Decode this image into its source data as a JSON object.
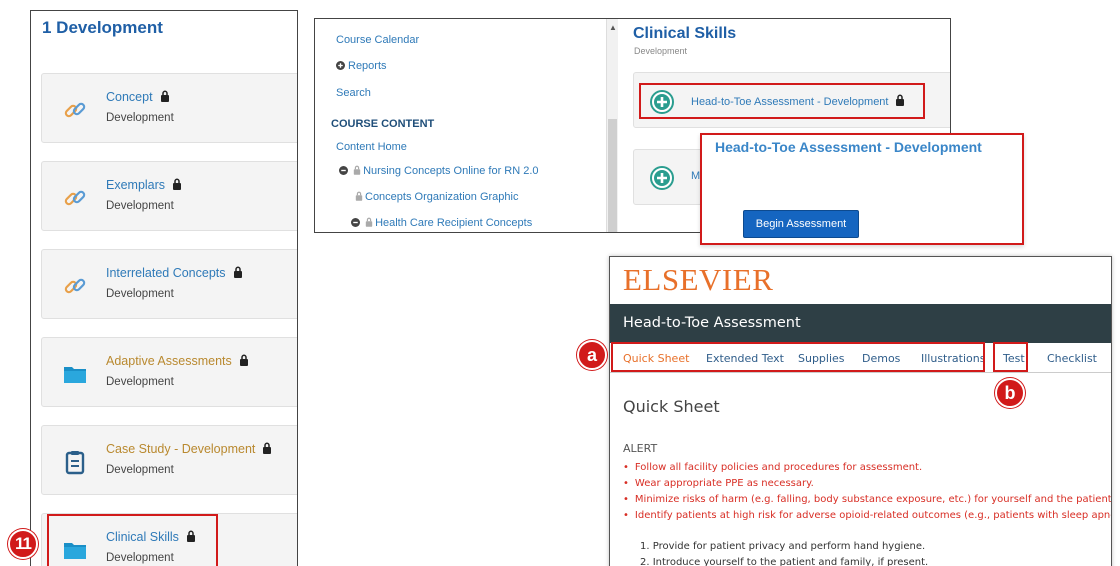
{
  "left_panel": {
    "title": "1 Development",
    "modules": [
      {
        "title": "Concept",
        "subtitle": "Development",
        "icon": "link-icon",
        "color": "blue"
      },
      {
        "title": "Exemplars",
        "subtitle": "Development",
        "icon": "link-icon",
        "color": "blue"
      },
      {
        "title": "Interrelated Concepts",
        "subtitle": "Development",
        "icon": "link-icon",
        "color": "blue"
      },
      {
        "title": "Adaptive Assessments",
        "subtitle": "Development",
        "icon": "folder-icon",
        "color": "orange"
      },
      {
        "title": "Case Study - Development",
        "subtitle": "Development",
        "icon": "clipboard-icon",
        "color": "orange"
      },
      {
        "title": "Clinical Skills",
        "subtitle": "Development",
        "icon": "folder-icon",
        "color": "blue"
      }
    ]
  },
  "mid_panel": {
    "sidebar": {
      "course_calendar": "Course Calendar",
      "reports": "Reports",
      "search": "Search",
      "course_content_heading": "COURSE CONTENT",
      "content_home": "Content Home",
      "tree": [
        "Nursing Concepts Online for RN 2.0",
        "Concepts Organization Graphic",
        "Health Care Recipient Concepts"
      ]
    },
    "main": {
      "title": "Clinical Skills",
      "subtitle": "Development",
      "cards": [
        {
          "text": "Head-to-Toe Assessment - Development"
        },
        {
          "text": "M"
        }
      ]
    }
  },
  "popup": {
    "title": "Head-to-Toe Assessment - Development",
    "button_label": "Begin Assessment"
  },
  "elsevier": {
    "logo": "ELSEVIER",
    "bar_title": "Head-to-Toe Assessment",
    "tabs": [
      "Quick Sheet",
      "Extended Text",
      "Supplies",
      "Demos",
      "Illustrations",
      "Test",
      "Checklist"
    ],
    "active_tab": "Quick Sheet",
    "section_title": "Quick Sheet",
    "alert_label": "ALERT",
    "alerts": [
      "Follow all facility policies and procedures for assessment.",
      "Wear appropriate PPE as necessary.",
      "Minimize risks of harm (e.g. falling, body substance exposure, etc.) for yourself and the patient.",
      "Identify patients at high risk for adverse opioid-related outcomes (e.g., patients with sleep apnea"
    ],
    "steps": [
      "1. Provide for patient privacy and perform hand hygiene.",
      "2. Introduce yourself to the patient and family, if present."
    ]
  },
  "annotations": {
    "badge_11": "11",
    "badge_a": "a",
    "badge_b": "b"
  },
  "colors": {
    "highlight": "#d11a1a",
    "link_blue": "#2f7ab8",
    "title_blue": "#1f5fa6",
    "elsevier_orange": "#e8702a",
    "elsevier_bar": "#2e3f45",
    "alert_red": "#d82e25",
    "button_blue": "#1565c0"
  }
}
